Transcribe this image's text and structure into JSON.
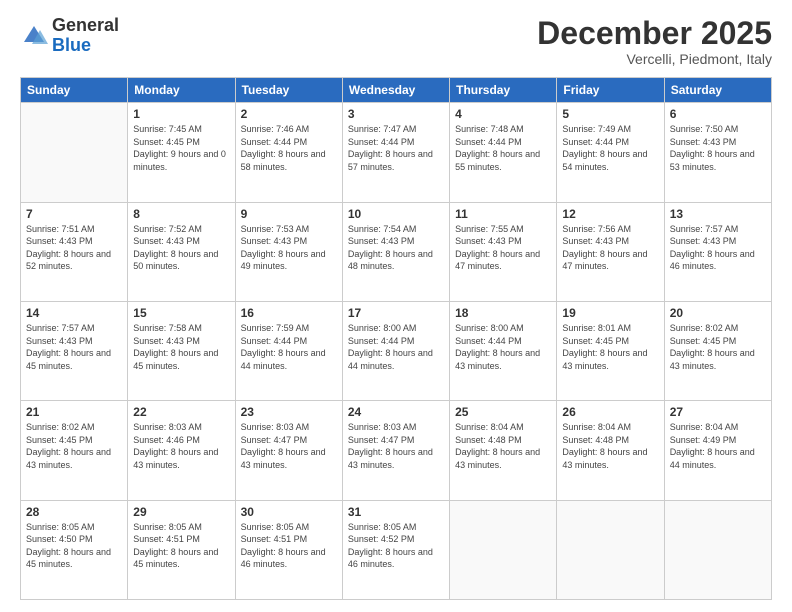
{
  "logo": {
    "general": "General",
    "blue": "Blue"
  },
  "header": {
    "month": "December 2025",
    "location": "Vercelli, Piedmont, Italy"
  },
  "days_of_week": [
    "Sunday",
    "Monday",
    "Tuesday",
    "Wednesday",
    "Thursday",
    "Friday",
    "Saturday"
  ],
  "weeks": [
    [
      {
        "day": "",
        "sunrise": "",
        "sunset": "",
        "daylight": ""
      },
      {
        "day": "1",
        "sunrise": "7:45 AM",
        "sunset": "4:45 PM",
        "daylight": "9 hours and 0 minutes."
      },
      {
        "day": "2",
        "sunrise": "7:46 AM",
        "sunset": "4:44 PM",
        "daylight": "8 hours and 58 minutes."
      },
      {
        "day": "3",
        "sunrise": "7:47 AM",
        "sunset": "4:44 PM",
        "daylight": "8 hours and 57 minutes."
      },
      {
        "day": "4",
        "sunrise": "7:48 AM",
        "sunset": "4:44 PM",
        "daylight": "8 hours and 55 minutes."
      },
      {
        "day": "5",
        "sunrise": "7:49 AM",
        "sunset": "4:44 PM",
        "daylight": "8 hours and 54 minutes."
      },
      {
        "day": "6",
        "sunrise": "7:50 AM",
        "sunset": "4:43 PM",
        "daylight": "8 hours and 53 minutes."
      }
    ],
    [
      {
        "day": "7",
        "sunrise": "7:51 AM",
        "sunset": "4:43 PM",
        "daylight": "8 hours and 52 minutes."
      },
      {
        "day": "8",
        "sunrise": "7:52 AM",
        "sunset": "4:43 PM",
        "daylight": "8 hours and 50 minutes."
      },
      {
        "day": "9",
        "sunrise": "7:53 AM",
        "sunset": "4:43 PM",
        "daylight": "8 hours and 49 minutes."
      },
      {
        "day": "10",
        "sunrise": "7:54 AM",
        "sunset": "4:43 PM",
        "daylight": "8 hours and 48 minutes."
      },
      {
        "day": "11",
        "sunrise": "7:55 AM",
        "sunset": "4:43 PM",
        "daylight": "8 hours and 47 minutes."
      },
      {
        "day": "12",
        "sunrise": "7:56 AM",
        "sunset": "4:43 PM",
        "daylight": "8 hours and 47 minutes."
      },
      {
        "day": "13",
        "sunrise": "7:57 AM",
        "sunset": "4:43 PM",
        "daylight": "8 hours and 46 minutes."
      }
    ],
    [
      {
        "day": "14",
        "sunrise": "7:57 AM",
        "sunset": "4:43 PM",
        "daylight": "8 hours and 45 minutes."
      },
      {
        "day": "15",
        "sunrise": "7:58 AM",
        "sunset": "4:43 PM",
        "daylight": "8 hours and 45 minutes."
      },
      {
        "day": "16",
        "sunrise": "7:59 AM",
        "sunset": "4:44 PM",
        "daylight": "8 hours and 44 minutes."
      },
      {
        "day": "17",
        "sunrise": "8:00 AM",
        "sunset": "4:44 PM",
        "daylight": "8 hours and 44 minutes."
      },
      {
        "day": "18",
        "sunrise": "8:00 AM",
        "sunset": "4:44 PM",
        "daylight": "8 hours and 43 minutes."
      },
      {
        "day": "19",
        "sunrise": "8:01 AM",
        "sunset": "4:45 PM",
        "daylight": "8 hours and 43 minutes."
      },
      {
        "day": "20",
        "sunrise": "8:02 AM",
        "sunset": "4:45 PM",
        "daylight": "8 hours and 43 minutes."
      }
    ],
    [
      {
        "day": "21",
        "sunrise": "8:02 AM",
        "sunset": "4:45 PM",
        "daylight": "8 hours and 43 minutes."
      },
      {
        "day": "22",
        "sunrise": "8:03 AM",
        "sunset": "4:46 PM",
        "daylight": "8 hours and 43 minutes."
      },
      {
        "day": "23",
        "sunrise": "8:03 AM",
        "sunset": "4:47 PM",
        "daylight": "8 hours and 43 minutes."
      },
      {
        "day": "24",
        "sunrise": "8:03 AM",
        "sunset": "4:47 PM",
        "daylight": "8 hours and 43 minutes."
      },
      {
        "day": "25",
        "sunrise": "8:04 AM",
        "sunset": "4:48 PM",
        "daylight": "8 hours and 43 minutes."
      },
      {
        "day": "26",
        "sunrise": "8:04 AM",
        "sunset": "4:48 PM",
        "daylight": "8 hours and 43 minutes."
      },
      {
        "day": "27",
        "sunrise": "8:04 AM",
        "sunset": "4:49 PM",
        "daylight": "8 hours and 44 minutes."
      }
    ],
    [
      {
        "day": "28",
        "sunrise": "8:05 AM",
        "sunset": "4:50 PM",
        "daylight": "8 hours and 45 minutes."
      },
      {
        "day": "29",
        "sunrise": "8:05 AM",
        "sunset": "4:51 PM",
        "daylight": "8 hours and 45 minutes."
      },
      {
        "day": "30",
        "sunrise": "8:05 AM",
        "sunset": "4:51 PM",
        "daylight": "8 hours and 46 minutes."
      },
      {
        "day": "31",
        "sunrise": "8:05 AM",
        "sunset": "4:52 PM",
        "daylight": "8 hours and 46 minutes."
      },
      {
        "day": "",
        "sunrise": "",
        "sunset": "",
        "daylight": ""
      },
      {
        "day": "",
        "sunrise": "",
        "sunset": "",
        "daylight": ""
      },
      {
        "day": "",
        "sunrise": "",
        "sunset": "",
        "daylight": ""
      }
    ]
  ]
}
